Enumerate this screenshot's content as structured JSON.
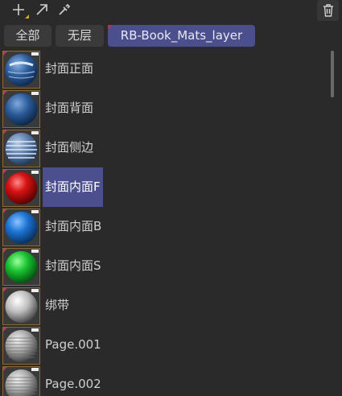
{
  "toolbar": {
    "buttons": [
      {
        "name": "add-icon"
      },
      {
        "name": "arrow-icon"
      },
      {
        "name": "eyedropper-icon"
      }
    ],
    "delete_icon": "trash-icon"
  },
  "tabs": [
    {
      "label": "全部"
    },
    {
      "label": "无层"
    },
    {
      "label": "RB-Book_Mats_layer",
      "active": true
    }
  ],
  "materials": [
    {
      "label": "封面正面",
      "ball": "textured-blue"
    },
    {
      "label": "封面背面",
      "ball": "blue"
    },
    {
      "label": "封面侧边",
      "ball": "striped-blue"
    },
    {
      "label": "封面内面F",
      "ball": "red",
      "selected": true
    },
    {
      "label": "封面内面B",
      "ball": "bright-blue"
    },
    {
      "label": "封面内面S",
      "ball": "green"
    },
    {
      "label": "绑带",
      "ball": "white"
    },
    {
      "label": "Page.001",
      "ball": "lined-white"
    },
    {
      "label": "Page.002",
      "ball": "lined-white"
    }
  ],
  "colors": {
    "background": "#2a2a2a",
    "accent": "#4b4f8e",
    "tab": "#3a3a3a"
  }
}
